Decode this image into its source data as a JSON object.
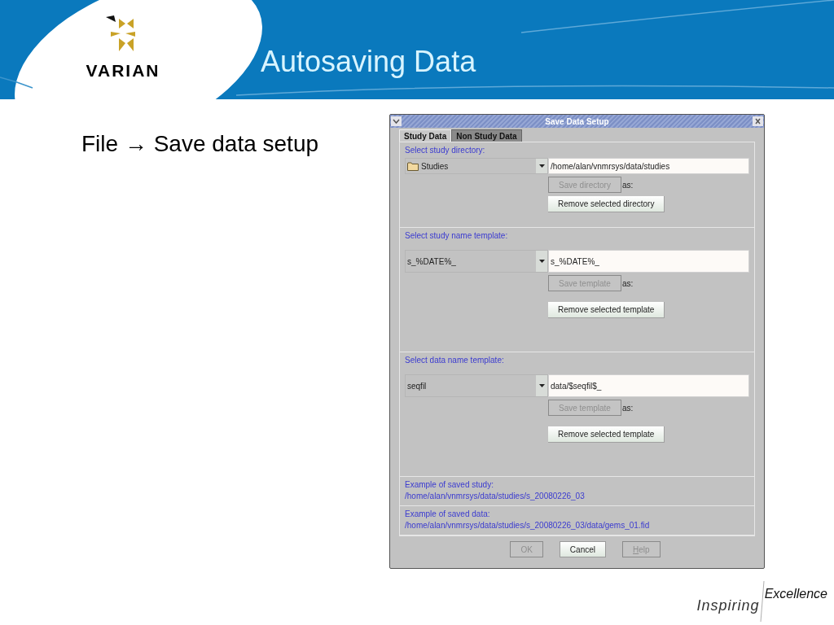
{
  "slide": {
    "title": "Autosaving Data",
    "logo": "VARIAN",
    "heading": "File → Save data setup",
    "tagline": [
      "Inspiring",
      "Excellence"
    ]
  },
  "dialog": {
    "title": "Save Data Setup",
    "tabs": [
      {
        "label": "Study Data",
        "selected": true
      },
      {
        "label": "Non Study Data",
        "selected": false
      }
    ],
    "sections": [
      {
        "kind": "directory",
        "label": "Select study directory:",
        "combo": "Studies",
        "field": "/home/alan/vnmrsys/data/studies",
        "save_button": {
          "label": "Save directory",
          "disabled": true
        },
        "as_label": "as:",
        "remove_button": "Remove selected directory"
      },
      {
        "kind": "template",
        "label": "Select study name template:",
        "combo": "s_%DATE%_",
        "field": "s_%DATE%_",
        "save_button": {
          "label": "Save template",
          "disabled": true
        },
        "as_label": "as:",
        "remove_button": "Remove selected template"
      },
      {
        "kind": "template",
        "label": "Select data name template:",
        "combo": "seqfil",
        "field": "data/$seqfil$_",
        "save_button": {
          "label": "Save template",
          "disabled": true
        },
        "as_label": "as:",
        "remove_button": "Remove selected template"
      }
    ],
    "examples": [
      {
        "label": "Example of saved study:",
        "path": "/home/alan/vnmrsys/data/studies/s_20080226_03"
      },
      {
        "label": "Example of saved data:",
        "path": "/home/alan/vnmrsys/data/studies/s_20080226_03/data/gems_01.fid"
      }
    ],
    "buttons": [
      {
        "label": "OK",
        "disabled": true,
        "mnemonic": false
      },
      {
        "label": "Cancel",
        "disabled": false,
        "mnemonic": false
      },
      {
        "label": "Help",
        "disabled": true,
        "mnemonic": true
      }
    ]
  }
}
